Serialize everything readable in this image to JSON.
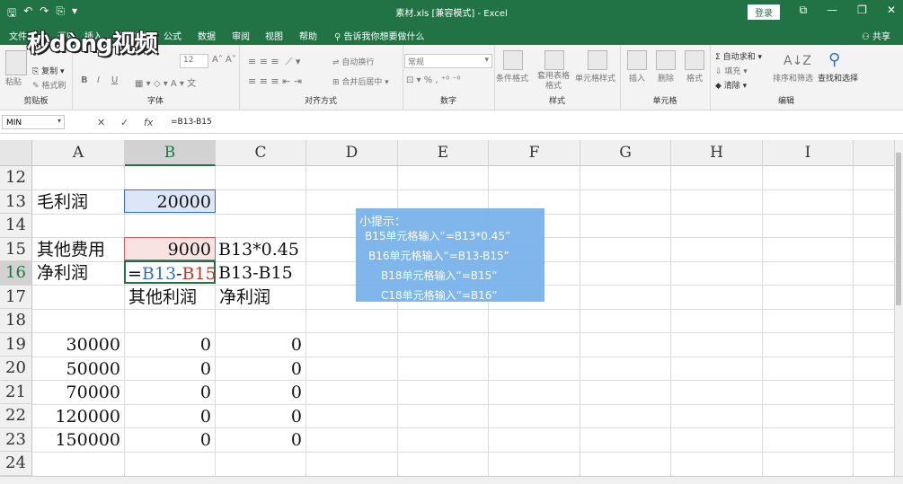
{
  "titlebar": {
    "title": "素材.xls [兼容模式] - Excel",
    "login": "登录",
    "qat": [
      "🖫",
      "↶",
      "↷",
      "⎘",
      "▾"
    ],
    "win": [
      "⧉",
      "—",
      "❐",
      "✕"
    ]
  },
  "logo": "秒dòng视频",
  "tabs": {
    "items": [
      "文件",
      "开始",
      "插入",
      "页面布局",
      "公式",
      "数据",
      "审阅",
      "视图",
      "帮助"
    ],
    "tell": "告诉我你想要做什么",
    "share": "共享"
  },
  "ribbon": {
    "clipboard": {
      "label": "剪贴板",
      "paste": "粘贴",
      "copy": "复制",
      "format_painter": "格式刷"
    },
    "font": {
      "label": "字体",
      "size": "12",
      "bold": "B",
      "italic": "I",
      "underline": "U"
    },
    "align": {
      "label": "对齐方式",
      "wrap": "自动换行",
      "merge": "合并后居中"
    },
    "number": {
      "label": "数字",
      "format": "常规",
      "percent": "%"
    },
    "styles": {
      "label": "样式",
      "cond": "条件格式",
      "table": "套用表格格式",
      "cell_style": "单元格样式"
    },
    "cells": {
      "label": "单元格",
      "insert": "插入",
      "delete": "删除",
      "format": "格式"
    },
    "edit": {
      "label": "编辑",
      "autosum": "自动求和",
      "fill": "填充",
      "clear": "清除",
      "sort": "排序和筛选",
      "find": "查找和选择"
    }
  },
  "formula_bar": {
    "name_box": "MIN",
    "formula": "=B13-B15",
    "cancel": "✕",
    "enter": "✓",
    "fx": "fx"
  },
  "columns": [
    "A",
    "B",
    "C",
    "D",
    "E",
    "F",
    "G",
    "H",
    "I"
  ],
  "rows": [
    "12",
    "13",
    "14",
    "15",
    "16",
    "17",
    "18",
    "19",
    "20",
    "21",
    "22",
    "23",
    "24"
  ],
  "cells": {
    "a13": "毛利润",
    "b13": "20000",
    "a15": "其他费用",
    "b15": "9000",
    "c15": "B13*0.45",
    "a16": "净利润",
    "b16_eq": "=",
    "b16_ref1": "B13",
    "b16_minus": "-",
    "b16_ref2": "B15",
    "c16": "B13-B15",
    "b17": "其他利润",
    "c17": "净利润",
    "a19": "30000",
    "b19": "0",
    "c19": "0",
    "a20": "50000",
    "b20": "0",
    "c20": "0",
    "a21": "70000",
    "b21": "0",
    "c21": "0",
    "a22": "120000",
    "b22": "0",
    "c22": "0",
    "a23": "150000",
    "b23": "0",
    "c23": "0"
  },
  "tip": {
    "title": "小提示：",
    "lines": [
      "B15单元格输入“=B13*0.45”",
      "B16单元格输入“=B13-B15”",
      "B18单元格输入“=B15”",
      "C18单元格输入“=B16”"
    ]
  },
  "colors": {
    "excel_green": "#217346",
    "tip_bg": "#79b4ec",
    "ref_blue": "#2f6fd4",
    "ref_red": "#c0392b"
  }
}
